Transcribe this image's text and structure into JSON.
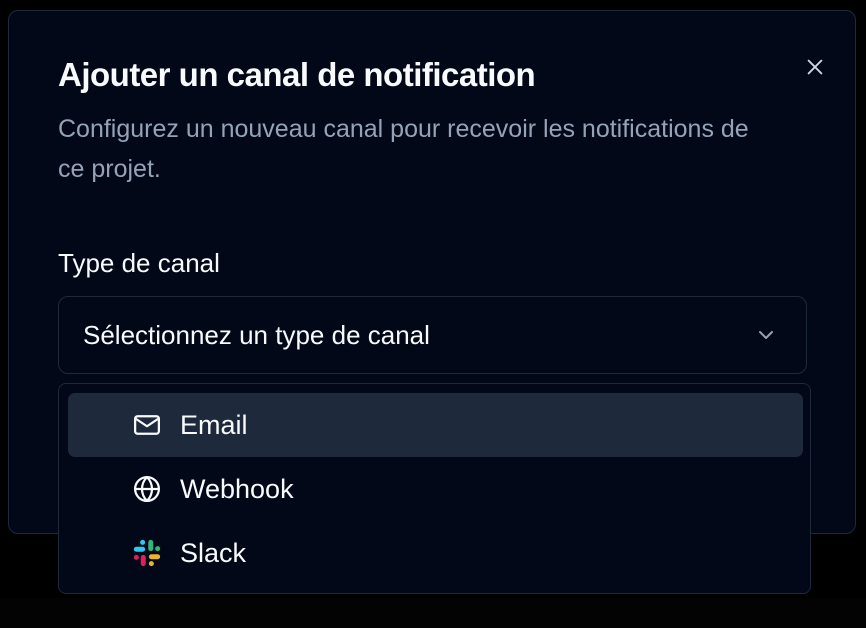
{
  "dialog": {
    "title": "Ajouter un canal de notification",
    "description": "Configurez un nouveau canal pour recevoir les notifications de ce projet.",
    "close_icon": "close-icon"
  },
  "field": {
    "label": "Type de canal",
    "placeholder": "Sélectionnez un type de canal",
    "chevron_icon": "chevron-down-icon"
  },
  "dropdown": {
    "options": [
      {
        "label": "Email",
        "icon": "mail-icon",
        "highlighted": true
      },
      {
        "label": "Webhook",
        "icon": "globe-icon",
        "highlighted": false
      },
      {
        "label": "Slack",
        "icon": "slack-icon",
        "highlighted": false
      }
    ]
  },
  "colors": {
    "background": "#020817",
    "border": "#1e293b",
    "highlight": "#1e293b",
    "text": "#f8fafc",
    "muted_text": "#94a3b8",
    "slack_red": "#e01e5a",
    "slack_blue": "#36c5f0",
    "slack_green": "#2eb67d",
    "slack_yellow": "#ecb22e"
  }
}
